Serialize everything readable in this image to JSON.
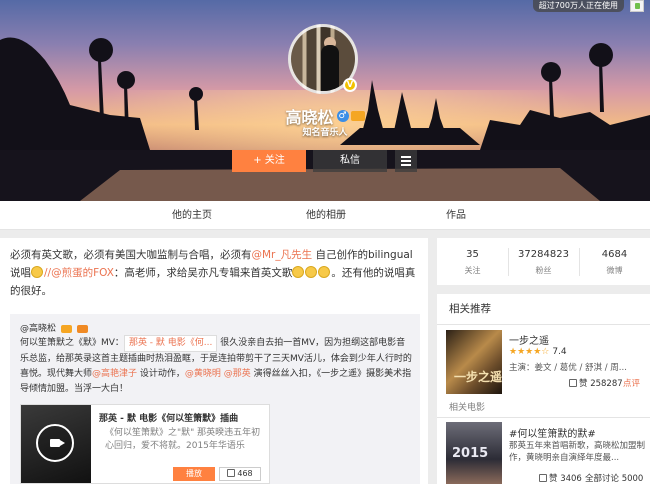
{
  "top_badge": "超过700万人正在使用",
  "profile": {
    "name": "高晓松",
    "gender_symbol": "♂",
    "verified_symbol": "V",
    "title": "知名音乐人"
  },
  "actions": {
    "follow_label": "+ 关注",
    "message_label": "私信"
  },
  "tabs": [
    {
      "label": "他的主页"
    },
    {
      "label": "他的相册"
    },
    {
      "label": "作品"
    }
  ],
  "post": {
    "line1_a": "必须有英文歌，必须有美国大咖监制与合唱，必须有",
    "mention1": "@Mr_凡先生",
    "line1_b": " 自己创作的bilingual说唱",
    "mention2": "//@煎蛋的FOX",
    "line2_a": "：高老师，求给吴亦凡专辑来首英文歌",
    "line2_b": "。还有他的说唱真的很好。",
    "repost": {
      "author": "@高晓松",
      "text_a": "何以笙箫默之《默》MV：",
      "media_tag": "那英 - 默 电影《何...",
      "text_b": " 很久没亲自去拍一首MV，因为担纲这部电影音乐总监，给那英录这首主题插曲时热泪盈眶，于是连拍带剪干了三天MV活儿，体会到少年人行时的喜悦。现代舞大师",
      "mention_a": "@高艳津子",
      "text_c": " 设计动作，",
      "mention_b": "@黄晓明",
      "mention_c": "@那英",
      "text_d": " 演得丝丝入扣，《一步之遥》摄影美术指导倾情加盟。当浮一大白！",
      "card": {
        "title": "那英 - 默 电影《何以笙箫默》插曲",
        "desc": "《何以笙箫默》之\"默\" 那英暌违五年初心回归，爱不将就。2015年华语乐",
        "play_label": "播放",
        "like_count": "468"
      }
    }
  },
  "stats": [
    {
      "num": "35",
      "label": "关注"
    },
    {
      "num": "37284823",
      "label": "粉丝"
    },
    {
      "num": "4684",
      "label": "微博"
    }
  ],
  "recommend": {
    "title": "相关推荐",
    "item1": {
      "poster_text": "一步之遥",
      "name": "一步之遥",
      "stars": "★★★★☆",
      "rating": "7.4",
      "info": "主演：姜文 / 葛优 / 舒淇 / 周...",
      "likes": "赞 258287",
      "rate_label": "点评"
    },
    "section_label": "相关电影",
    "item2": {
      "poster_text": "2015",
      "name": "#何以笙箫默的默#",
      "desc": "那英五年来首唱新歌，高晓松加盟制作，黄晓明亲自演绎年度最...",
      "likes": "赞 3406",
      "discuss": "全部讨论 5000"
    }
  }
}
